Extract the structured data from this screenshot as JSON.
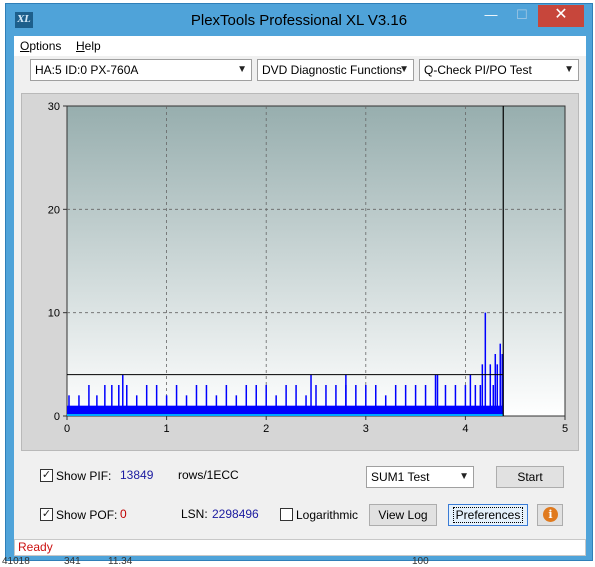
{
  "window": {
    "title": "PlexTools Professional XL V3.16",
    "icon_text": "XL",
    "minimize_glyph": "—",
    "maximize_glyph": "☐",
    "close_glyph": "✕"
  },
  "menu": {
    "options": "ptions",
    "options_accel": "O",
    "help": "elp",
    "help_accel": "H"
  },
  "toolbar": {
    "drive": "HA:5 ID:0  PX-760A",
    "function": "DVD Diagnostic Functions",
    "test": "Q-Check PI/PO Test"
  },
  "chart_data": {
    "type": "bar",
    "xlim": [
      0,
      5
    ],
    "ylim": [
      0,
      30
    ],
    "x_ticks": [
      "0",
      "1",
      "2",
      "3",
      "4",
      "5"
    ],
    "y_ticks": [
      "0",
      "10",
      "20",
      "30"
    ],
    "grid": true,
    "threshold_line": 4,
    "end_marker_x": 4.38,
    "series": [
      {
        "color": "#0000ff",
        "x": [
          0.02,
          0.12,
          0.22,
          0.3,
          0.38,
          0.45,
          0.52,
          0.56,
          0.6,
          0.7,
          0.8,
          0.9,
          1.0,
          1.1,
          1.2,
          1.3,
          1.4,
          1.5,
          1.6,
          1.7,
          1.8,
          1.9,
          2.0,
          2.1,
          2.2,
          2.3,
          2.4,
          2.45,
          2.5,
          2.6,
          2.7,
          2.8,
          2.8,
          2.9,
          3.0,
          3.1,
          3.2,
          3.3,
          3.4,
          3.5,
          3.6,
          3.7,
          3.72,
          3.8,
          3.9,
          4.0,
          4.05,
          4.1,
          4.15,
          4.17,
          4.2,
          4.25,
          4.28,
          4.3,
          4.32,
          4.35,
          4.37
        ],
        "y": [
          2,
          2,
          3,
          2,
          3,
          3,
          3,
          4,
          3,
          2,
          3,
          3,
          2,
          3,
          2,
          3,
          3,
          2,
          3,
          2,
          3,
          3,
          3,
          2,
          3,
          3,
          2,
          4,
          3,
          3,
          3,
          3,
          4,
          3,
          3,
          3,
          2,
          3,
          3,
          3,
          3,
          4,
          4,
          3,
          3,
          3,
          4,
          3,
          3,
          5,
          10,
          5,
          3,
          6,
          5,
          7,
          6
        ]
      }
    ]
  },
  "controls": {
    "show_pif_label": "Show PIF:",
    "pif_value": "13849",
    "rows_label": "rows/1ECC",
    "show_pof_label": "Show POF:",
    "pof_value": "0",
    "lsn_label": "LSN:",
    "lsn_value": "2298496",
    "logarithmic_label": "Logarithmic",
    "sum_select": "SUM1 Test",
    "start_button": "Start",
    "view_log_button": "View Log",
    "preferences_button": "Preferences",
    "info_glyph": "i",
    "check_glyph": "✓"
  },
  "status": {
    "text": "Ready"
  },
  "background": {
    "col1": "41018",
    "col2": "341",
    "col3": "11.34",
    "col4": "100"
  }
}
